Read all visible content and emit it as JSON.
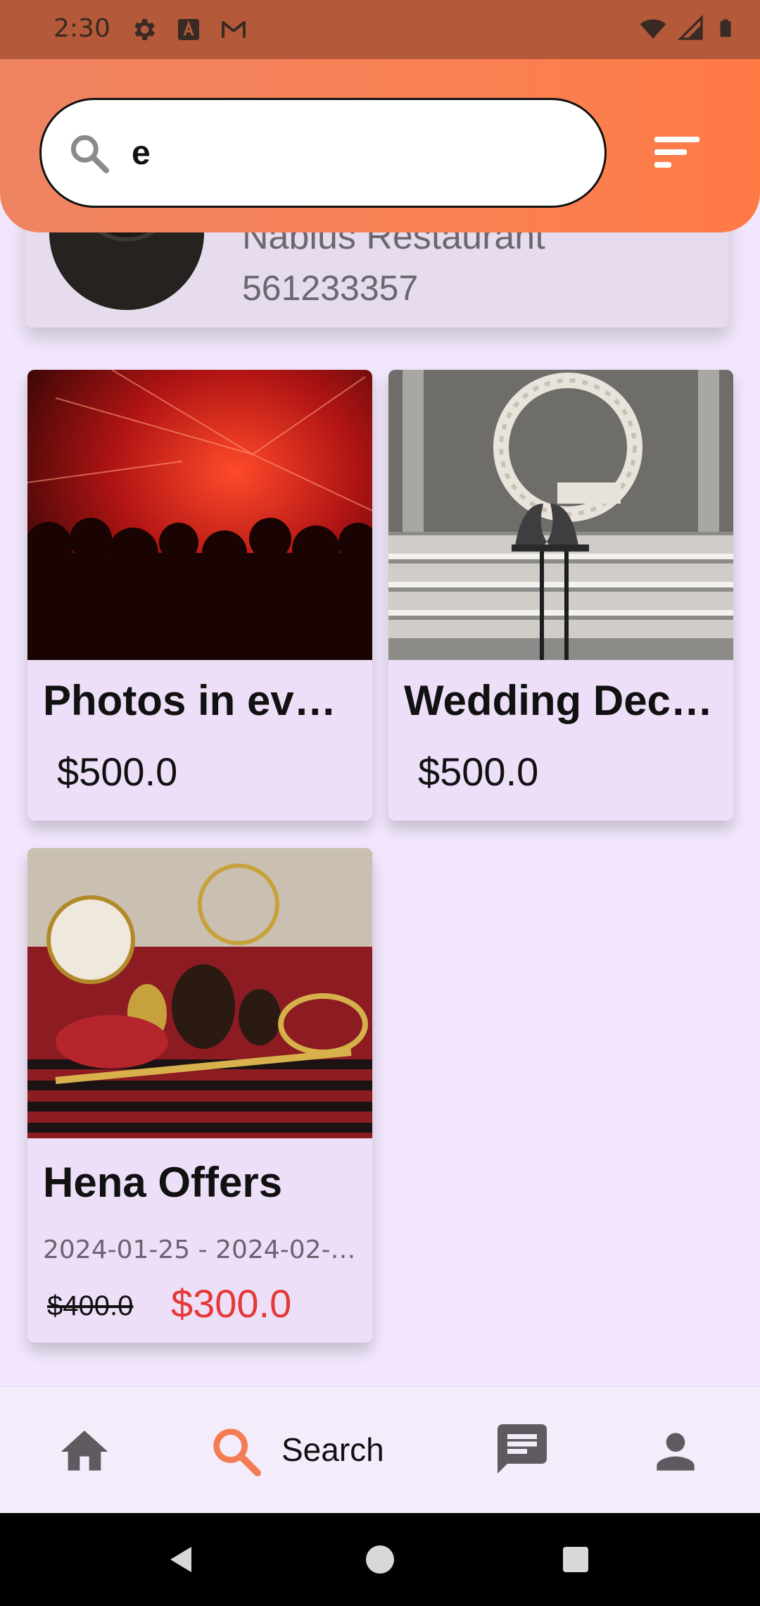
{
  "status_bar": {
    "time": "2:30"
  },
  "search": {
    "value": "e"
  },
  "restaurant": {
    "name": "Nablus   Restaurant",
    "phone": "561233357"
  },
  "products": [
    {
      "title": "Photos in even…",
      "price": "$500.0"
    },
    {
      "title": "Wedding Deco…",
      "price": "$500.0"
    },
    {
      "title": "Hena Offers",
      "dates": "2024-01-25 - 2024-02-…",
      "old_price": "$400.0",
      "price": "$300.0"
    }
  ],
  "bottom_nav": {
    "items": [
      {
        "icon": "home-icon"
      },
      {
        "icon": "search-icon",
        "label": "Search",
        "active": true
      },
      {
        "icon": "chat-icon"
      },
      {
        "icon": "person-icon"
      }
    ],
    "active_color": "#f47b52"
  },
  "colors": {
    "header": "#f98154",
    "accent": "#e53935"
  }
}
